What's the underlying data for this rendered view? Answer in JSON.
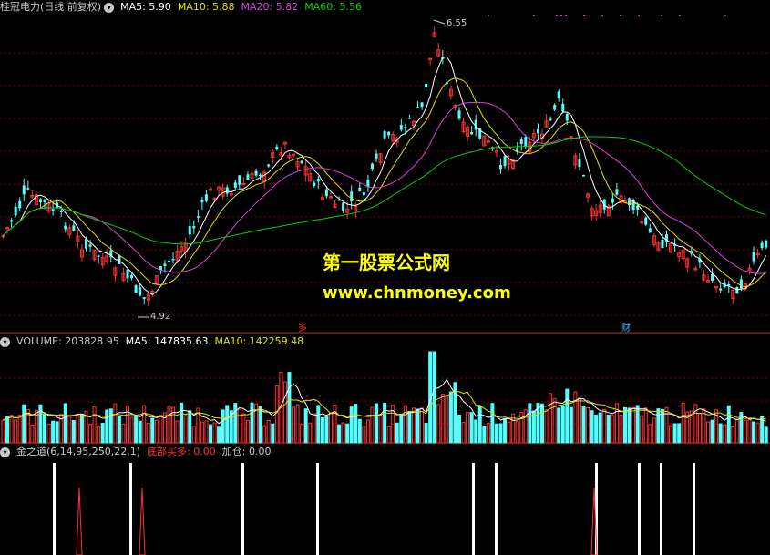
{
  "main_header": {
    "stock": "桂冠电力(日线 前复权)",
    "ma5": "MA5: 5.90",
    "ma10": "MA10: 5.88",
    "ma20": "MA20: 5.82",
    "ma60": "MA60: 5.56"
  },
  "volume_header": {
    "title": "VOLUME: 203828.95",
    "ma5": "MA5: 147835.63",
    "ma10": "MA10: 142259.48"
  },
  "indicator_header": {
    "title": "金之道(6,14,95,250,22,1)",
    "bottom_buy": "底部买多: 0.00",
    "add_position": "加仓: 0.00"
  },
  "annotations": {
    "high_label": "6.55",
    "low_label": "4.92",
    "marker_1": "多",
    "marker_2": "财"
  },
  "watermark": {
    "line1": "第一股票公式网",
    "line2": "www.chnmoney.com"
  },
  "colors": {
    "ma5": "#ffffff",
    "ma10": "#e0e000",
    "ma20": "#e040e0",
    "ma60": "#00d000",
    "up": "#ff3232",
    "down": "#54ffff",
    "grid": "#800000"
  },
  "icons": {
    "collapse": "chevron-down-icon"
  }
}
